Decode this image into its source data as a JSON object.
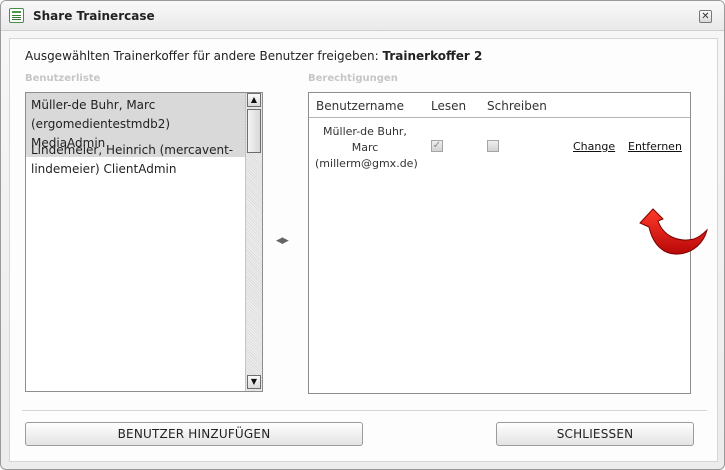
{
  "window": {
    "title": "Share Trainercase",
    "close_glyph": "✕"
  },
  "intro": {
    "text": "Ausgewählten Trainerkoffer für andere Benutzer freigeben: ",
    "case_name": "Trainerkoffer 2"
  },
  "userlist": {
    "label": "Benutzerliste",
    "items": [
      {
        "label": "Müller-de Buhr, Marc (ergomedientestmdb2) MediaAdmin",
        "selected": true
      },
      {
        "label": "Lindemeier, Heinrich (mercavent-lindemeier) ClientAdmin",
        "selected": false
      }
    ],
    "scroll_up": "▲",
    "scroll_down": "▼"
  },
  "transfer": {
    "glyph": "◀▶"
  },
  "permissions": {
    "label": "Berechtigungen",
    "columns": [
      "Benutzername",
      "Lesen",
      "Schreiben"
    ],
    "rows": [
      {
        "username": "Müller-de Buhr, Marc (millerm@gmx.de)",
        "read": true,
        "write": false,
        "change_label": "Change",
        "remove_label": "Entfernen"
      }
    ]
  },
  "buttons": {
    "add_users": "BENUTZER HINZUFÜGEN",
    "close": "SCHLIESSEN"
  },
  "colors": {
    "selection": "#d9d9d9",
    "annotation_arrow": "#d10f0f"
  }
}
